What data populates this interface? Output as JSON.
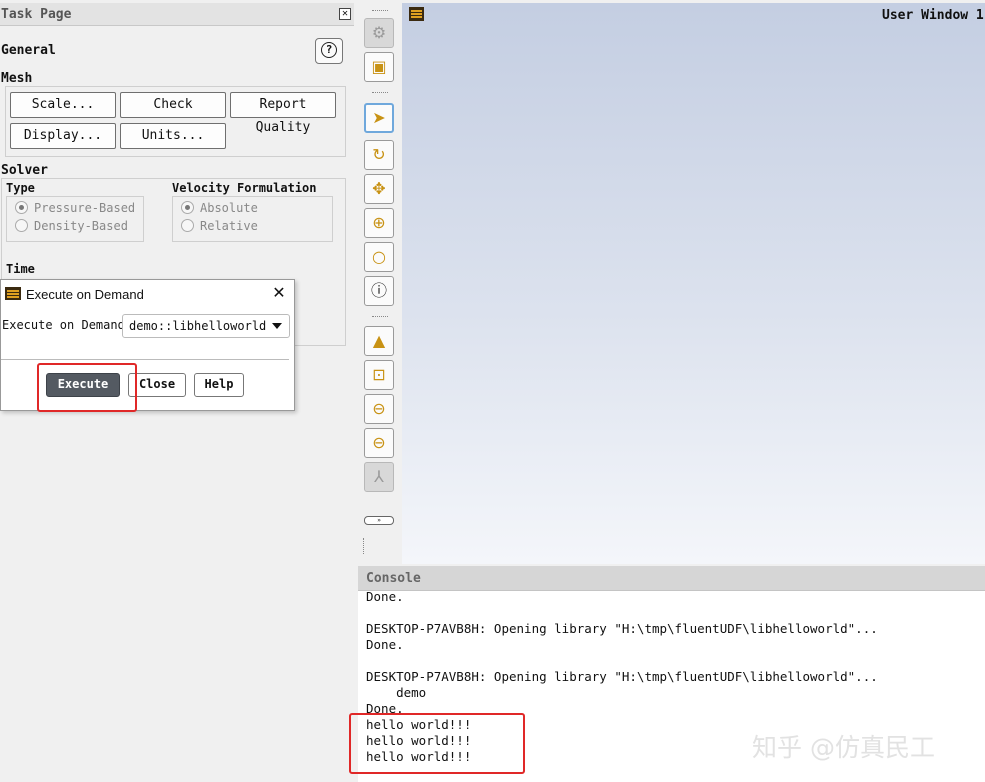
{
  "task_page": {
    "title": "Task Page",
    "close_glyph": "✕",
    "section_title": "General",
    "help_glyph": "?",
    "mesh": {
      "label": "Mesh",
      "buttons": [
        "Scale...",
        "Check",
        "Report Quality",
        "Display...",
        "Units..."
      ]
    },
    "solver": {
      "label": "Solver",
      "type_label": "Type",
      "type_options": [
        "Pressure-Based",
        "Density-Based"
      ],
      "type_selected": "Pressure-Based",
      "velocity_label": "Velocity Formulation",
      "velocity_options": [
        "Absolute",
        "Relative"
      ],
      "velocity_selected": "Absolute"
    },
    "time_label": "Time"
  },
  "dialog": {
    "title": "Execute on Demand",
    "close_glyph": "✕",
    "field_label": "Execute on Demand",
    "selected_value": "demo::libhelloworld",
    "execute_label": "Execute",
    "close_label": "Close",
    "help_label": "Help"
  },
  "toolbar": {
    "icons": [
      "globe-icon",
      "select-box-icon",
      "pointer-icon",
      "rotate-icon",
      "pan-icon",
      "zoom-in-out-icon",
      "zoom-icon",
      "info-icon",
      "model-icon",
      "zoom-fit-icon",
      "zoom-previous-icon",
      "zoom-out-icon",
      "axes-icon"
    ],
    "active": "pointer-icon",
    "pill_label": "»"
  },
  "graphics": {
    "window_title": "User Window 1"
  },
  "console": {
    "title": "Console",
    "lines": [
      "Done.",
      "",
      "DESKTOP-P7AVB8H: Opening library \"H:\\tmp\\fluentUDF\\libhelloworld\"...",
      "Done.",
      "",
      "DESKTOP-P7AVB8H: Opening library \"H:\\tmp\\fluentUDF\\libhelloworld\"...",
      "    demo",
      "Done.",
      "hello world!!!",
      "hello world!!!",
      "hello world!!!"
    ]
  },
  "watermark": "知乎 @仿真民工",
  "colors": {
    "highlight_box": "#e02828",
    "execute_button": "#545a62",
    "toolbar_icon": "#c89214"
  }
}
